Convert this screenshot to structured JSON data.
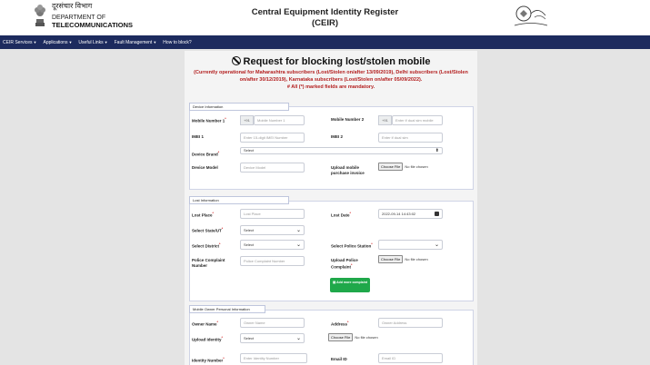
{
  "header": {
    "dept_hindi": "दूरसंचार विभाग",
    "dept_line1": "DEPARTMENT OF",
    "dept_line2": "TELECOMMUNICATIONS",
    "title_line1": "Central Equipment Identity Register",
    "title_line2": "(CEIR)"
  },
  "nav": [
    {
      "label": "CEIR Services",
      "caret": true
    },
    {
      "label": "Applications",
      "caret": true
    },
    {
      "label": "Useful Links",
      "caret": true
    },
    {
      "label": "Fault Management",
      "caret": true
    },
    {
      "label": "How to block?",
      "caret": false
    }
  ],
  "page": {
    "heading": "Request for blocking lost/stolen mobile",
    "notice": "(Currently operational for Maharashtra subscribers (Lost/Stolen on/after 13/09/2019), Delhi subscribers (Lost/Stolen on/after 30/12/2019), Karnataka subscribers (Lost/Stolen on/after 05/09/2022).",
    "mandatory": "# All (*) marked fields are mandatory."
  },
  "device": {
    "tab": "Device Information",
    "mobile1_label": "Mobile Number 1",
    "mobile1_prefix": "+91",
    "mobile1_placeholder": "Mobile Number 1",
    "mobile2_label": "Mobile Number 2",
    "mobile2_prefix": "+91",
    "mobile2_placeholder": "Enter if dual sim mobile",
    "imei1_label": "IMEI 1",
    "imei1_placeholder": "Enter 15-digit IMEI Number",
    "imei2_label": "IMEI 2",
    "imei2_placeholder": "Enter if dual sim",
    "brand_label": "Device Brand",
    "brand_value": "Select",
    "model_label": "Device Model",
    "model_placeholder": "Device Model",
    "invoice_label": "Upload mobile purchase invoice",
    "invoice_button": "Choose File",
    "invoice_status": "No file chosen"
  },
  "lost": {
    "tab": "Lost Information",
    "place_label": "Lost Place",
    "place_placeholder": "Lost Place",
    "date_label": "Lost Date",
    "date_value": "2022-09-14 14:43:02",
    "state_label": "Select State/UT",
    "state_value": "Select",
    "district_label": "Select District",
    "district_value": "Select",
    "station_label": "Select Police Station",
    "station_value": "",
    "complaint_no_label": "Police Complaint Number",
    "complaint_no_placeholder": "Police Complaint Number",
    "complaint_upload_label": "Upload Police Complaint",
    "complaint_button": "Choose File",
    "complaint_status": "No file chosen",
    "add_complaint": "Add more complaint"
  },
  "owner": {
    "tab": "Mobile Owner Personal Information",
    "name_label": "Owner Name",
    "name_placeholder": "Owner Name",
    "address_label": "Address",
    "address_placeholder": "Owner Address",
    "identity_label": "Upload Identity",
    "identity_value": "Select",
    "identity_button": "Choose File",
    "identity_status": "No file chosen",
    "idnum_label": "Identity Number",
    "idnum_placeholder": "Enter Identity Number",
    "email_label": "Email ID",
    "email_placeholder": "Email ID"
  }
}
